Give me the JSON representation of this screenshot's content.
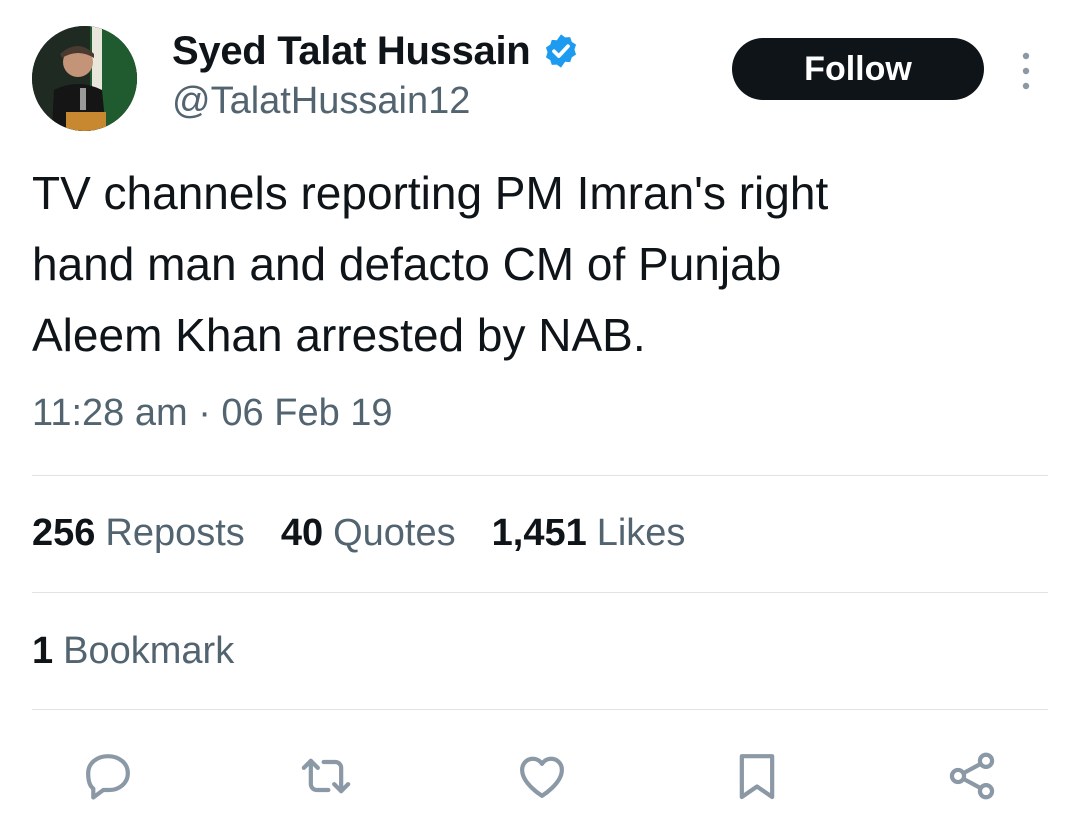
{
  "author": {
    "display_name": "Syed Talat Hussain",
    "handle": "@TalatHussain12",
    "verified_icon": "verified-badge-icon"
  },
  "header": {
    "follow_label": "Follow"
  },
  "tweet": {
    "text": "TV channels reporting PM Imran's right\nhand man and defacto CM of Punjab\nAleem Khan arrested by NAB.",
    "time": "11:28 am",
    "separator": "·",
    "date": "06 Feb 19"
  },
  "stats": {
    "reposts_count": "256",
    "reposts_label": "Reposts",
    "quotes_count": "40",
    "quotes_label": "Quotes",
    "likes_count": "1,451",
    "likes_label": "Likes",
    "bookmarks_count": "1",
    "bookmarks_label": "Bookmark"
  },
  "actions": [
    "reply-icon",
    "repost-icon",
    "like-icon",
    "bookmark-icon",
    "share-icon"
  ],
  "colors": {
    "text": "#0f1419",
    "secondary": "#536471",
    "verified": "#1d9bf0",
    "divider": "#dfe3e6",
    "button": "#0f1419"
  }
}
